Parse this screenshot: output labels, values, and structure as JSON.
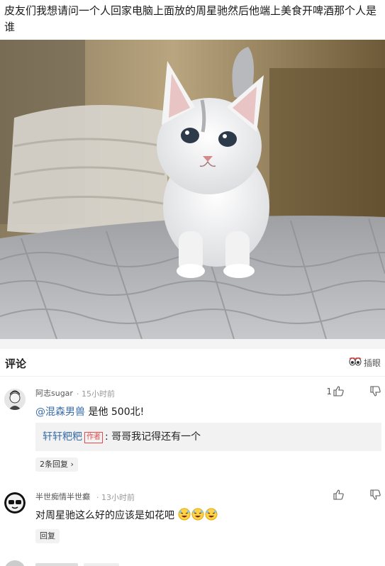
{
  "post": {
    "title": "皮友们我想请问一个人回家电脑上面放的周星驰然后他端上美食开啤酒那个人是谁"
  },
  "comments_header": {
    "title": "评论",
    "ins_label": "插眼",
    "ins_icon": "eyes-icon"
  },
  "comments": [
    {
      "name": "阿志sugar",
      "time": "· 15小时前",
      "like_count": "1",
      "mention": "@混森男兽",
      "text": " 是他   500北!",
      "reply": {
        "user": "轩轩粑粑",
        "badge": "作者",
        "text": ": 哥哥我记得还有一个"
      },
      "replies_link": "2条回复 ›"
    },
    {
      "name": "半世痴情半世癫",
      "time": "· 13小时前",
      "text": "对周星驰这么好的应该是如花吧",
      "emojis": [
        "laughing-emoji",
        "laughing-emoji",
        "laughing-emoji"
      ],
      "reply_button": "回复"
    }
  ],
  "colors": {
    "mention": "#3a6ea8",
    "badge": "#e64a4a",
    "divider": "#f4f4f4"
  }
}
